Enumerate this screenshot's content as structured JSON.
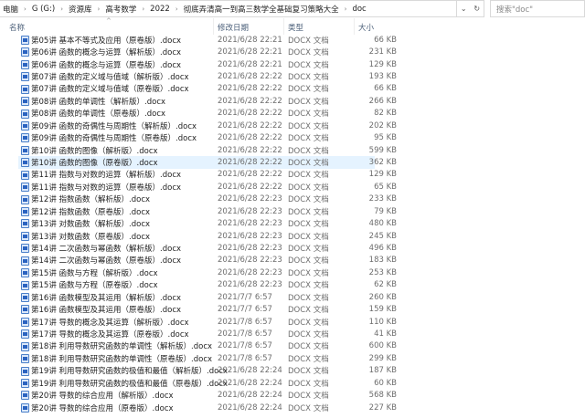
{
  "breadcrumb": [
    "电脑",
    "G (G:)",
    "资源库",
    "高考数学",
    "2022",
    "彻底弄清高一到高三数学全基础复习策略大全",
    "doc"
  ],
  "search": {
    "placeholder": "搜索\"doc\""
  },
  "columns": {
    "name": "名称",
    "date": "修改日期",
    "type": "类型",
    "size": "大小"
  },
  "selected_index": 10,
  "files": [
    {
      "name": "第05讲 基本不等式及应用（原卷版）.docx",
      "date": "2021/6/28 22:21",
      "type": "DOCX 文档",
      "size": "66 KB"
    },
    {
      "name": "第06讲 函数的概念与运算（解析版）.docx",
      "date": "2021/6/28 22:21",
      "type": "DOCX 文档",
      "size": "231 KB"
    },
    {
      "name": "第06讲 函数的概念与运算（原卷版）.docx",
      "date": "2021/6/28 22:21",
      "type": "DOCX 文档",
      "size": "129 KB"
    },
    {
      "name": "第07讲 函数的定义域与值域（解析版）.docx",
      "date": "2021/6/28 22:22",
      "type": "DOCX 文档",
      "size": "193 KB"
    },
    {
      "name": "第07讲 函数的定义域与值域（原卷版）.docx",
      "date": "2021/6/28 22:22",
      "type": "DOCX 文档",
      "size": "66 KB"
    },
    {
      "name": "第08讲 函数的单调性（解析版）.docx",
      "date": "2021/6/28 22:22",
      "type": "DOCX 文档",
      "size": "266 KB"
    },
    {
      "name": "第08讲 函数的单调性（原卷版）.docx",
      "date": "2021/6/28 22:22",
      "type": "DOCX 文档",
      "size": "82 KB"
    },
    {
      "name": "第09讲 函数的奇偶性与周期性（解析版）.docx",
      "date": "2021/6/28 22:22",
      "type": "DOCX 文档",
      "size": "202 KB"
    },
    {
      "name": "第09讲 函数的奇偶性与周期性（原卷版）.docx",
      "date": "2021/6/28 22:22",
      "type": "DOCX 文档",
      "size": "95 KB"
    },
    {
      "name": "第10讲 函数的图像（解析版）.docx",
      "date": "2021/6/28 22:22",
      "type": "DOCX 文档",
      "size": "599 KB"
    },
    {
      "name": "第10讲 函数的图像（原卷版）.docx",
      "date": "2021/6/28 22:22",
      "type": "DOCX 文档",
      "size": "362 KB"
    },
    {
      "name": "第11讲 指数与对数的运算（解析版）.docx",
      "date": "2021/6/28 22:22",
      "type": "DOCX 文档",
      "size": "129 KB"
    },
    {
      "name": "第11讲 指数与对数的运算（原卷版）.docx",
      "date": "2021/6/28 22:22",
      "type": "DOCX 文档",
      "size": "65 KB"
    },
    {
      "name": "第12讲 指数函数（解析版）.docx",
      "date": "2021/6/28 22:23",
      "type": "DOCX 文档",
      "size": "233 KB"
    },
    {
      "name": "第12讲 指数函数（原卷版）.docx",
      "date": "2021/6/28 22:23",
      "type": "DOCX 文档",
      "size": "79 KB"
    },
    {
      "name": "第13讲 对数函数（解析版）.docx",
      "date": "2021/6/28 22:23",
      "type": "DOCX 文档",
      "size": "480 KB"
    },
    {
      "name": "第13讲 对数函数（原卷版）.docx",
      "date": "2021/6/28 22:23",
      "type": "DOCX 文档",
      "size": "245 KB"
    },
    {
      "name": "第14讲 二次函数与幂函数（解析版）.docx",
      "date": "2021/6/28 22:23",
      "type": "DOCX 文档",
      "size": "496 KB"
    },
    {
      "name": "第14讲 二次函数与幂函数（原卷版）.docx",
      "date": "2021/6/28 22:23",
      "type": "DOCX 文档",
      "size": "183 KB"
    },
    {
      "name": "第15讲 函数与方程（解析版）.docx",
      "date": "2021/6/28 22:23",
      "type": "DOCX 文档",
      "size": "253 KB"
    },
    {
      "name": "第15讲 函数与方程（原卷版）.docx",
      "date": "2021/6/28 22:23",
      "type": "DOCX 文档",
      "size": "62 KB"
    },
    {
      "name": "第16讲 函数模型及其运用（解析版）.docx",
      "date": "2021/7/7 6:57",
      "type": "DOCX 文档",
      "size": "260 KB"
    },
    {
      "name": "第16讲 函数模型及其运用（原卷版）.docx",
      "date": "2021/7/7 6:57",
      "type": "DOCX 文档",
      "size": "159 KB"
    },
    {
      "name": "第17讲 导数的概念及其运算（解析版）.docx",
      "date": "2021/7/8 6:57",
      "type": "DOCX 文档",
      "size": "110 KB"
    },
    {
      "name": "第17讲 导数的概念及其运算（原卷版）.docx",
      "date": "2021/7/8 6:57",
      "type": "DOCX 文档",
      "size": "41 KB"
    },
    {
      "name": "第18讲 利用导数研究函数的单调性（解析版）.docx",
      "date": "2021/7/8 6:57",
      "type": "DOCX 文档",
      "size": "600 KB"
    },
    {
      "name": "第18讲 利用导数研究函数的单调性（原卷版）.docx",
      "date": "2021/7/8 6:57",
      "type": "DOCX 文档",
      "size": "299 KB"
    },
    {
      "name": "第19讲 利用导数研究函数的极值和最值（解析版）.docx",
      "date": "2021/6/28 22:24",
      "type": "DOCX 文档",
      "size": "187 KB"
    },
    {
      "name": "第19讲 利用导数研究函数的极值和最值（原卷版）.docx",
      "date": "2021/6/28 22:24",
      "type": "DOCX 文档",
      "size": "60 KB"
    },
    {
      "name": "第20讲 导数的综合应用（解析版）.docx",
      "date": "2021/6/28 22:24",
      "type": "DOCX 文档",
      "size": "568 KB"
    },
    {
      "name": "第20讲 导数的综合应用（原卷版）.docx",
      "date": "2021/6/28 22:24",
      "type": "DOCX 文档",
      "size": "227 KB"
    }
  ]
}
